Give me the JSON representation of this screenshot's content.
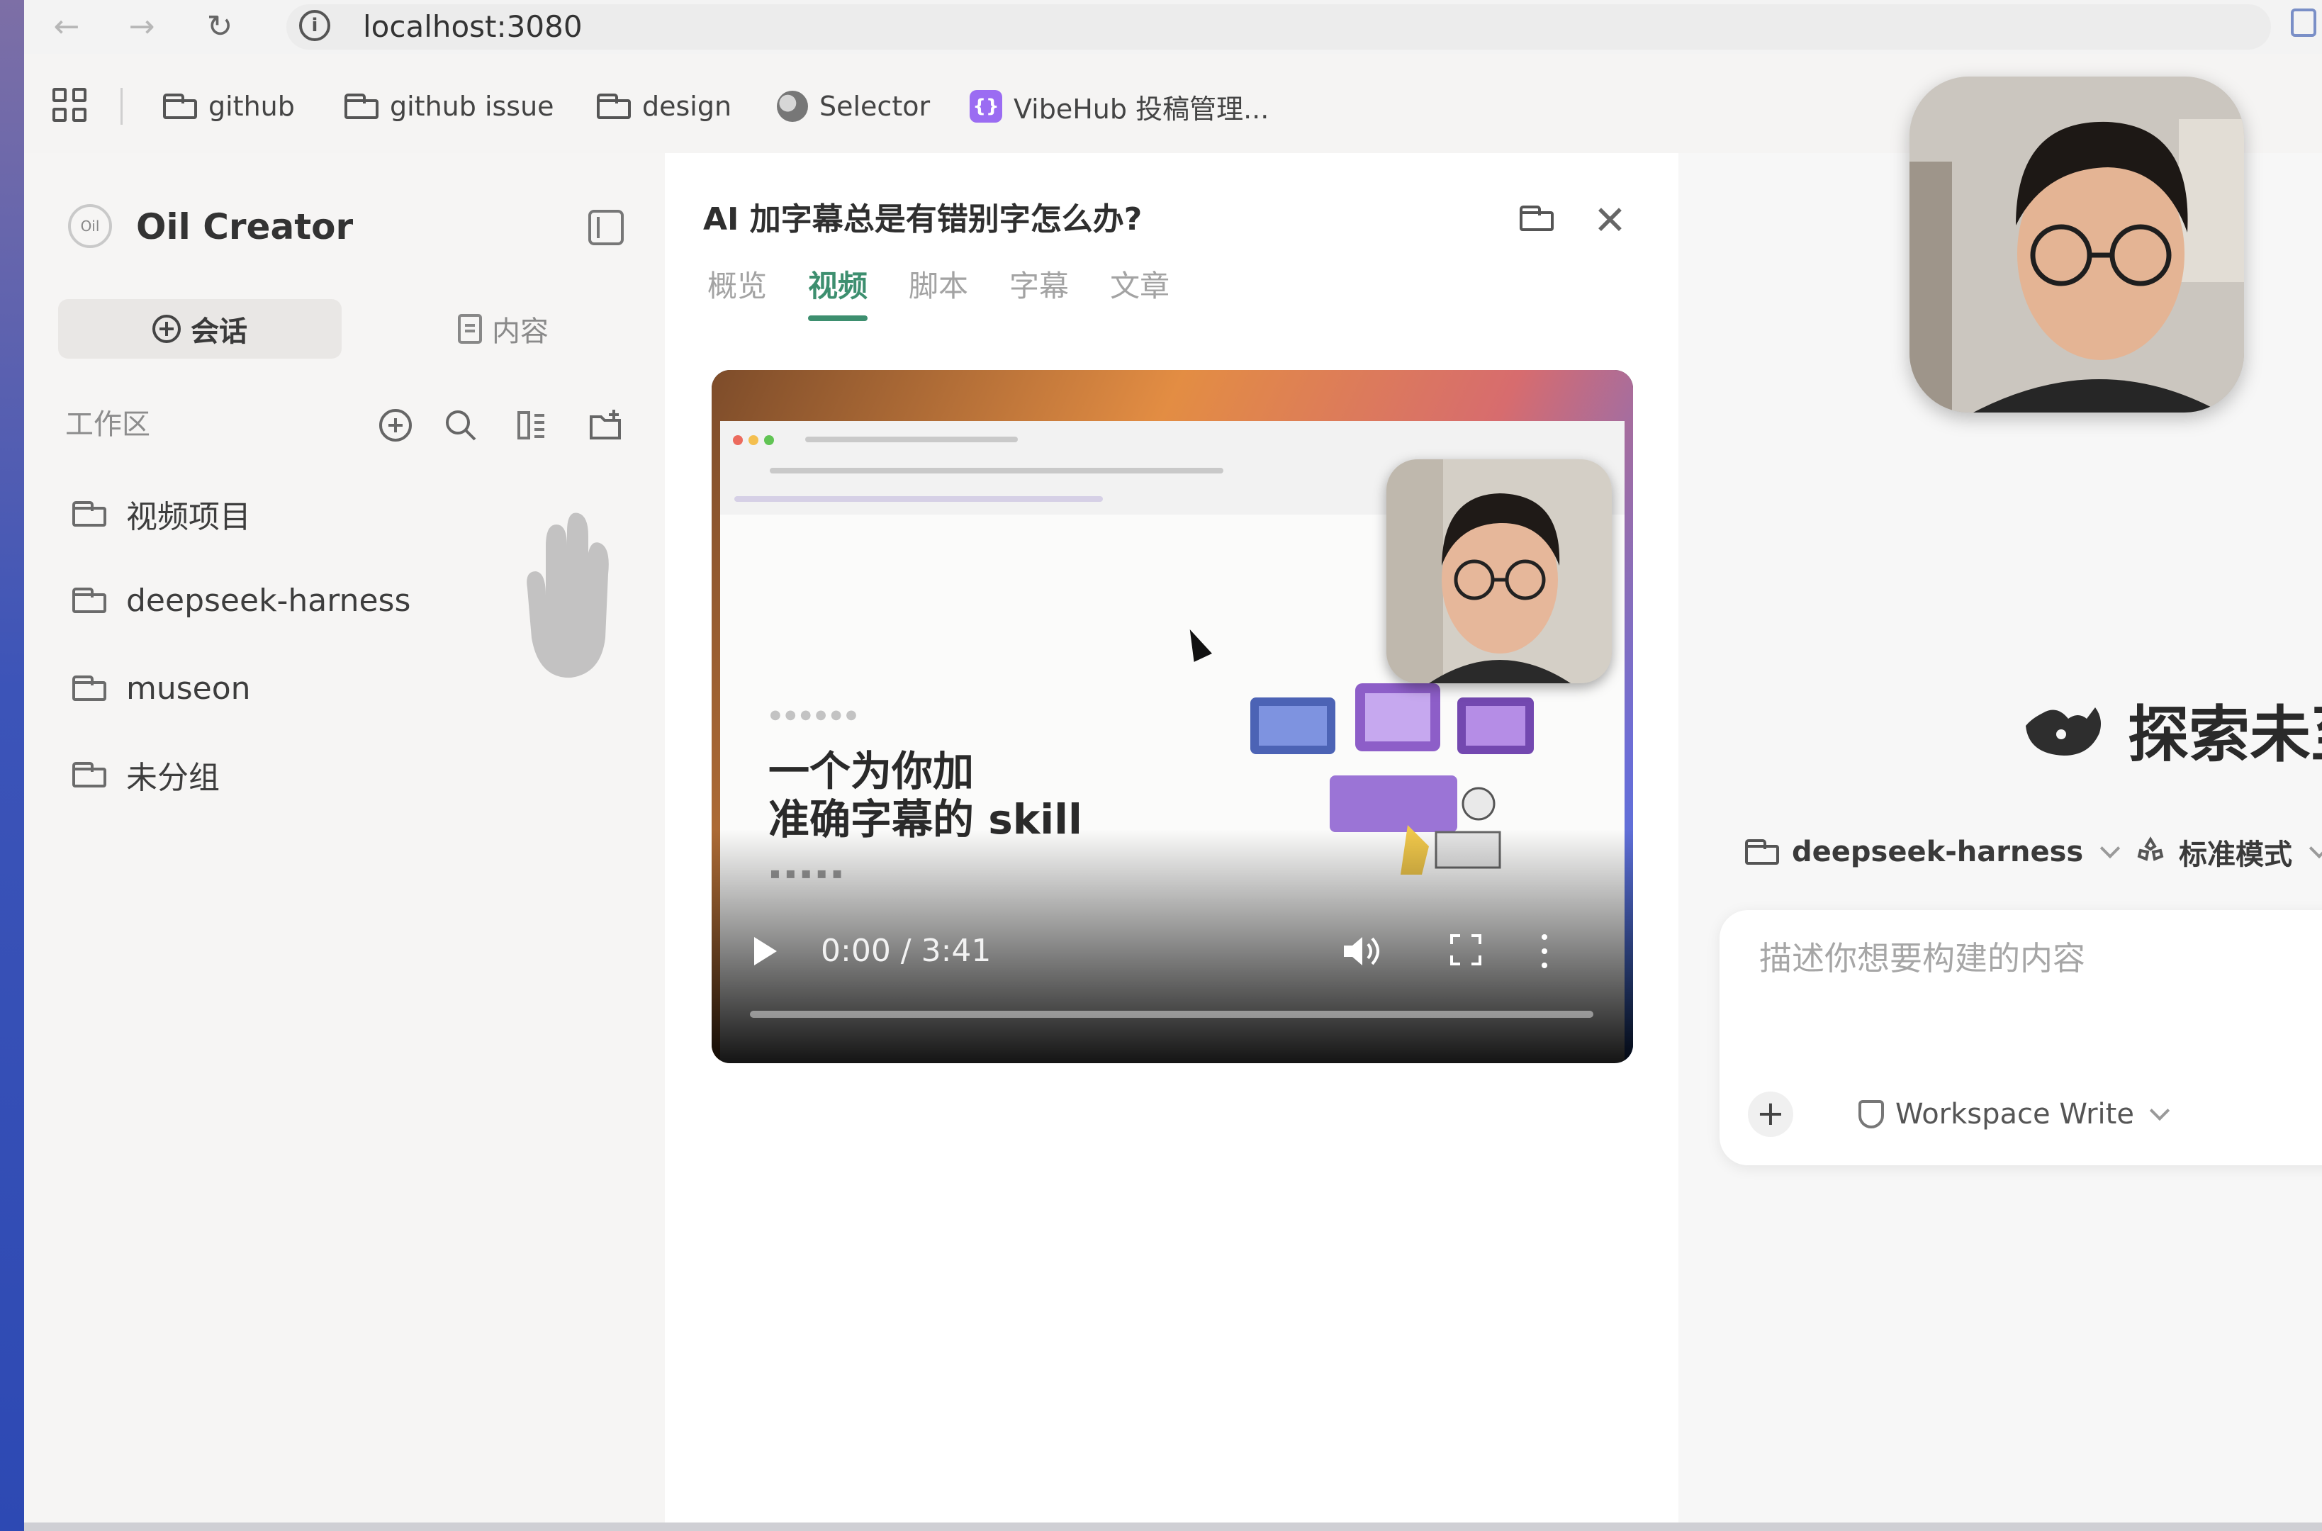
{
  "browser": {
    "url": "localhost:3080",
    "bookmarks": [
      {
        "label": "github",
        "icon": "folder-icon"
      },
      {
        "label": "github issue",
        "icon": "folder-icon"
      },
      {
        "label": "design",
        "icon": "folder-icon"
      },
      {
        "label": "Selector",
        "icon": "globe-icon"
      },
      {
        "label": "VibeHub 投稿管理...",
        "icon": "vibehub-icon"
      }
    ]
  },
  "sidebar": {
    "app_title": "Oil Creator",
    "tabs": [
      {
        "label": "会话",
        "icon": "plus-circle-icon",
        "active": true
      },
      {
        "label": "内容",
        "icon": "document-icon",
        "active": false
      }
    ],
    "workspace_label": "工作区",
    "workspaces": [
      "视频项目",
      "deepseek-harness",
      "museon",
      "未分组"
    ]
  },
  "panel": {
    "title": "AI 加字幕总是有错别字怎么办?",
    "tabs": [
      {
        "label": "概览",
        "active": false
      },
      {
        "label": "视频",
        "active": true
      },
      {
        "label": "脚本",
        "active": false
      },
      {
        "label": "字幕",
        "active": false
      },
      {
        "label": "文章",
        "active": false
      }
    ],
    "video": {
      "time": "0:00 / 3:41",
      "progress": 0,
      "frame_headline": "一个为你加\n准确字幕的 skill"
    }
  },
  "chat": {
    "hero_title": "探索未至",
    "workspace_chip": "deepseek-harness",
    "mode_chip": "标准模式",
    "composer_placeholder": "描述你想要构建的内容",
    "permission": "Workspace Write"
  },
  "colors": {
    "accent": "#3d8f6f",
    "vibehub": "#9b6cf2"
  }
}
